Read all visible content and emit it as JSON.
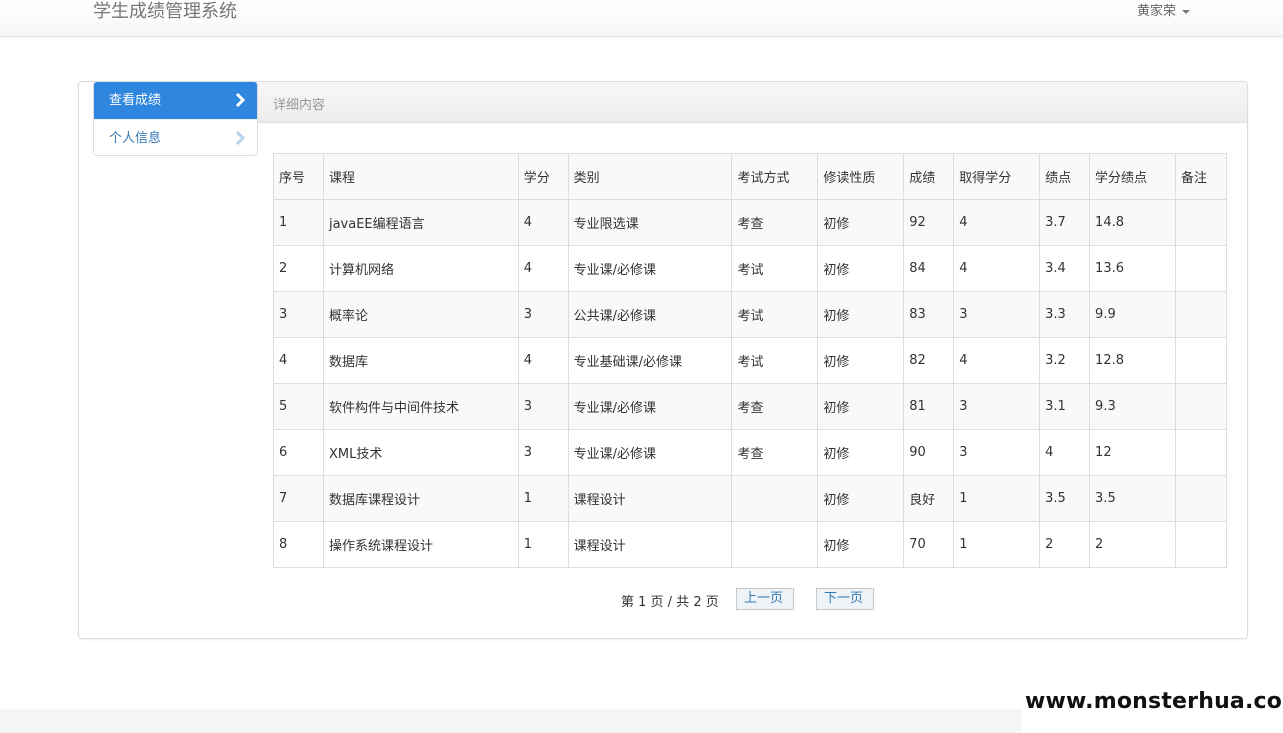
{
  "app": {
    "title": "学生成绩管理系统",
    "user": "黄家荣"
  },
  "sidebar": {
    "items": [
      {
        "label": "查看成绩",
        "active": true
      },
      {
        "label": "个人信息",
        "active": false
      }
    ]
  },
  "panel": {
    "heading": "详细内容"
  },
  "table": {
    "headers": [
      "序号",
      "课程",
      "学分",
      "类别",
      "考试方式",
      "修读性质",
      "成绩",
      "取得学分",
      "绩点",
      "学分绩点",
      "备注"
    ],
    "rows": [
      [
        "1",
        "javaEE编程语言",
        "4",
        "专业限选课",
        "考查",
        "初修",
        "92",
        "4",
        "3.7",
        "14.8",
        ""
      ],
      [
        "2",
        "计算机网络",
        "4",
        "专业课/必修课",
        "考试",
        "初修",
        "84",
        "4",
        "3.4",
        "13.6",
        ""
      ],
      [
        "3",
        "概率论",
        "3",
        "公共课/必修课",
        "考试",
        "初修",
        "83",
        "3",
        "3.3",
        "9.9",
        ""
      ],
      [
        "4",
        "数据库",
        "4",
        "专业基础课/必修课",
        "考试",
        "初修",
        "82",
        "4",
        "3.2",
        "12.8",
        ""
      ],
      [
        "5",
        "软件构件与中间件技术",
        "3",
        "专业课/必修课",
        "考查",
        "初修",
        "81",
        "3",
        "3.1",
        "9.3",
        ""
      ],
      [
        "6",
        "XML技术",
        "3",
        "专业课/必修课",
        "考查",
        "初修",
        "90",
        "3",
        "4",
        "12",
        ""
      ],
      [
        "7",
        "数据库课程设计",
        "1",
        "课程设计",
        "",
        "初修",
        "良好",
        "1",
        "3.5",
        "3.5",
        ""
      ],
      [
        "8",
        "操作系统课程设计",
        "1",
        "课程设计",
        "",
        "初修",
        "70",
        "1",
        "2",
        "2",
        ""
      ]
    ]
  },
  "pagination": {
    "info": "第 1 页 / 共 2 页",
    "prev_label": "上一页",
    "next_label": "下一页"
  },
  "watermark": "www.monsterhua.com",
  "colors": {
    "accent": "#2e86de",
    "link": "#337ab7"
  }
}
